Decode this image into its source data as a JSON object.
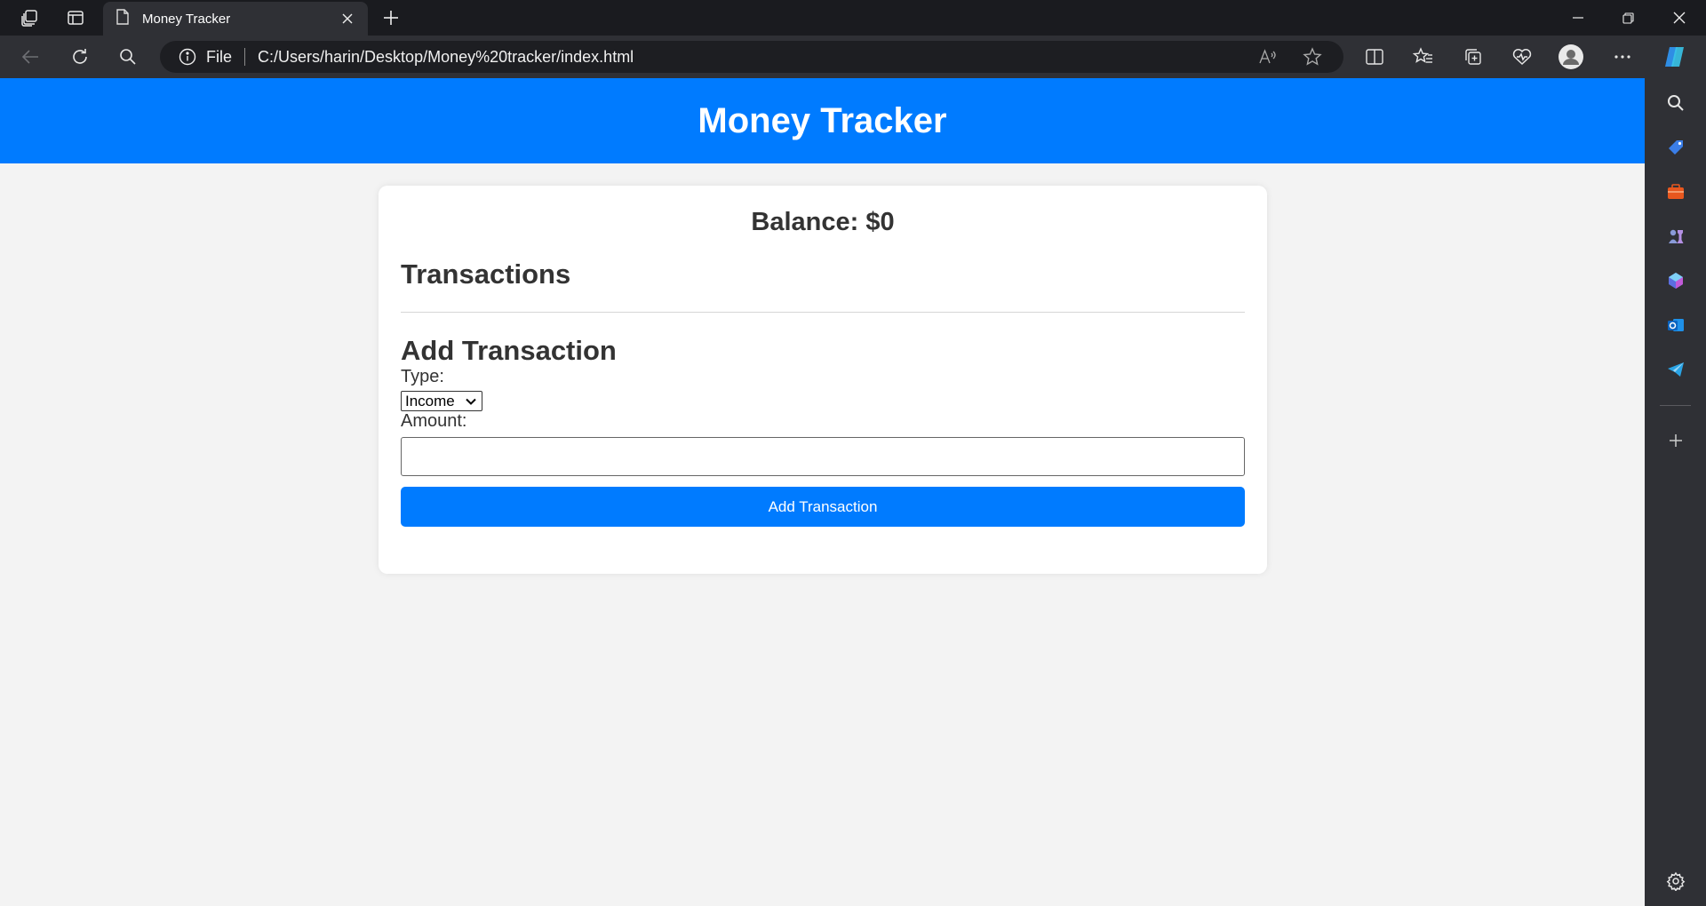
{
  "browser": {
    "tab_title": "Money Tracker",
    "address_scheme_label": "File",
    "address_url": "C:/Users/harin/Desktop/Money%20tracker/index.html"
  },
  "app": {
    "title": "Money Tracker",
    "balance_text": "Balance: $0",
    "transactions_heading": "Transactions",
    "transactions": [],
    "add_heading": "Add Transaction",
    "type_label": "Type:",
    "type_selected": "Income",
    "amount_label": "Amount:",
    "amount_value": "",
    "add_button_label": "Add Transaction"
  },
  "colors": {
    "accent": "#007bff",
    "page_background": "#f3f3f3",
    "chrome_dark": "#1a1b1f",
    "chrome_toolbar": "#2f3035"
  }
}
